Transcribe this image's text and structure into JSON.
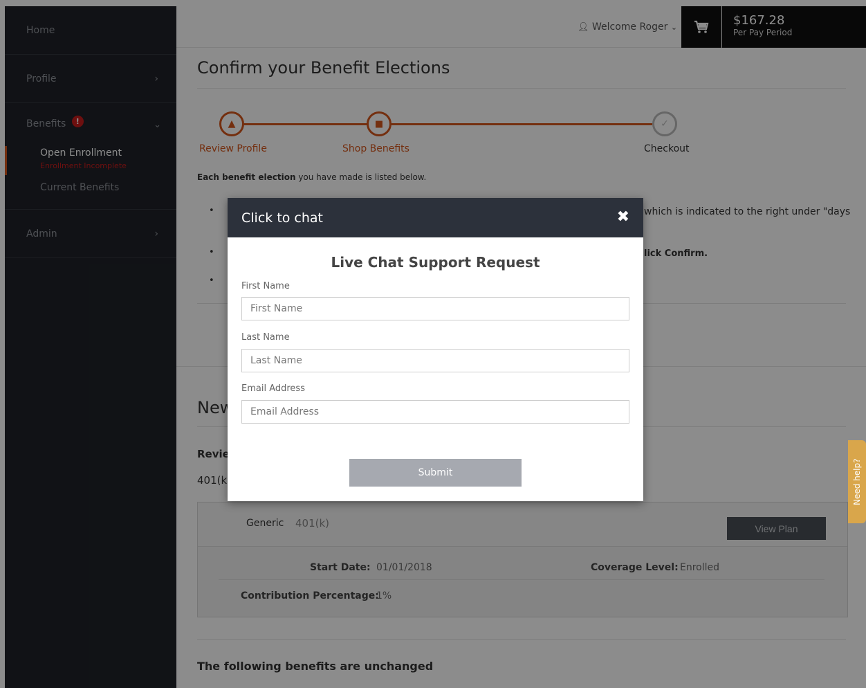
{
  "sidebar": {
    "home": "Home",
    "profile": "Profile",
    "benefits": "Benefits",
    "benefits_badge": "!",
    "open_enrollment": "Open Enrollment",
    "enrollment_status": "Enrollment Incomplete",
    "current_benefits": "Current Benefits",
    "admin": "Admin"
  },
  "topbar": {
    "welcome": "Welcome Roger",
    "total_amount": "$167.28",
    "total_period": "Per Pay Period"
  },
  "page": {
    "title": "Confirm your Benefit Elections",
    "steps": [
      "Review Profile",
      "Shop Benefits",
      "Checkout"
    ],
    "intro_bold": "Each benefit election",
    "intro_rest": " you have made is listed below.",
    "bullet1_visible": "which is indicated to the right under \"days",
    "bullet2_visible": "lick Confirm.",
    "new_section": "New",
    "review_label": "Revie",
    "plan_type_partial": "401(k",
    "plan_card": {
      "provider": "Generic",
      "plan": "401(k)",
      "view_plan": "View Plan",
      "start_date_label": "Start Date:",
      "start_date_value": "01/01/2018",
      "coverage_label": "Coverage Level:",
      "coverage_value": "Enrolled",
      "contribution_label": "Contribution Percentage:",
      "contribution_value": "1%"
    },
    "unchanged_heading": "The following benefits are unchanged"
  },
  "need_help": "Need help?",
  "modal": {
    "header": "Click to chat",
    "close": "✖",
    "title": "Live Chat Support Request",
    "first_name_label": "First Name",
    "first_name_placeholder": "First Name",
    "last_name_label": "Last Name",
    "last_name_placeholder": "Last Name",
    "email_label": "Email Address",
    "email_placeholder": "Email Address",
    "submit": "Submit"
  }
}
